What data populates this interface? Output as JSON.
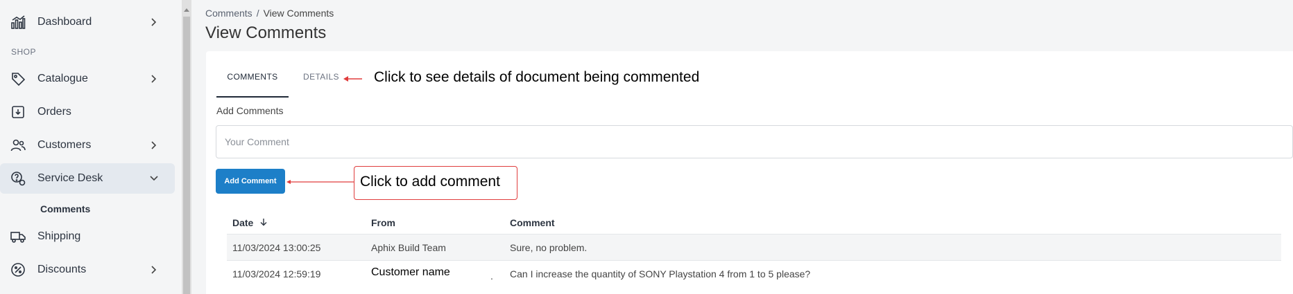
{
  "sidebar": {
    "items": [
      {
        "label": "Dashboard",
        "icon": "dashboard-icon",
        "has_chevron": true
      },
      {
        "label": "Catalogue",
        "icon": "tag-icon",
        "has_chevron": true
      },
      {
        "label": "Orders",
        "icon": "orders-box-icon",
        "has_chevron": false
      },
      {
        "label": "Customers",
        "icon": "users-icon",
        "has_chevron": true
      },
      {
        "label": "Service Desk",
        "icon": "service-desk-icon",
        "has_chevron": true,
        "expanded": true,
        "active": true
      },
      {
        "label": "Shipping",
        "icon": "truck-icon",
        "has_chevron": false
      },
      {
        "label": "Discounts",
        "icon": "discount-icon",
        "has_chevron": true
      }
    ],
    "section_label": "SHOP",
    "subitem": "Comments"
  },
  "breadcrumb": {
    "parent": "Comments",
    "separator": "/",
    "current": "View Comments"
  },
  "page_title": "View Comments",
  "tabs": [
    {
      "label": "COMMENTS",
      "active": true
    },
    {
      "label": "DETAILS",
      "active": false
    }
  ],
  "annotations": {
    "details_hint": "Click to see details of document being commented",
    "add_hint": "Click to add comment"
  },
  "form": {
    "label": "Add Comments",
    "placeholder": "Your Comment",
    "button": "Add Comment"
  },
  "table": {
    "headers": {
      "date": "Date",
      "from": "From",
      "comment": "Comment"
    },
    "sort_icon": "arrow-down-icon",
    "rows": [
      {
        "date": "11/03/2024 13:00:25",
        "from": "Aphix Build Team",
        "comment": "Sure, no problem."
      },
      {
        "date": "11/03/2024 12:59:19",
        "from": "Customer name",
        "comment": "Can I increase the quantity of SONY Playstation 4 from 1 to 5 please?"
      }
    ],
    "trailing_mark": "."
  },
  "colors": {
    "accent": "#1d7fc8",
    "annotation": "#e03c3c",
    "active_nav": "#e4e9ef"
  }
}
